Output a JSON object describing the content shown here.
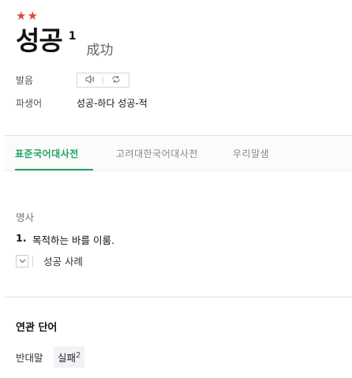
{
  "entry": {
    "stars": "★★",
    "headword": "성공",
    "homonym_number": "1",
    "hanja": "成功"
  },
  "info": {
    "pronunciation_label": "발음",
    "derivative_label": "파생어",
    "derivatives": "성공-하다 성공-적"
  },
  "tabs": [
    {
      "label": "표준국어대사전",
      "active": true
    },
    {
      "label": "고려대한국어대사전",
      "active": false
    },
    {
      "label": "우리말샘",
      "active": false
    }
  ],
  "definition": {
    "part_of_speech": "명사",
    "number": "1.",
    "text": "목적하는 바를 이룸.",
    "examples_label": "성공 사례"
  },
  "related": {
    "title": "연관 단어",
    "antonym_label": "반대말",
    "antonym_word": "실패",
    "antonym_homonym": "2"
  },
  "colors": {
    "accent": "#1ea362",
    "stars": "#dd4b39"
  }
}
